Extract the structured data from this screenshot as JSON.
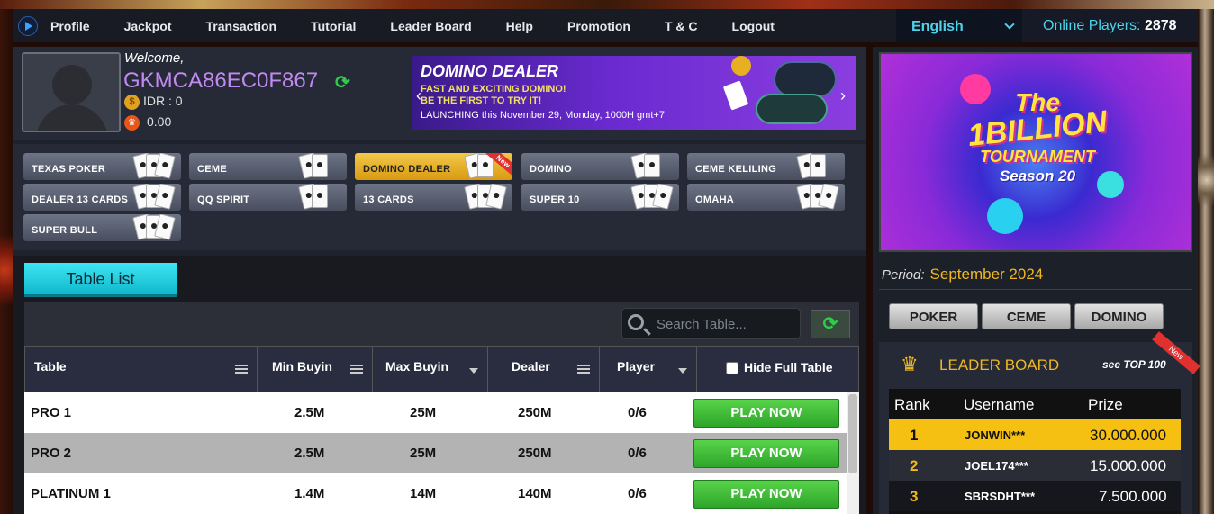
{
  "nav": {
    "items": [
      "Profile",
      "Jackpot",
      "Transaction",
      "Tutorial",
      "Leader Board",
      "Help",
      "Promotion",
      "T & C",
      "Logout"
    ],
    "language": "English",
    "online_label": "Online Players:",
    "online_count": "2878"
  },
  "user": {
    "welcome": "Welcome,",
    "username": "GKMCA86EC0F867",
    "balance": "IDR : 0",
    "points": "0.00"
  },
  "banner": {
    "title": "DOMINO DEALER",
    "line1": "FAST AND EXCITING DOMINO!",
    "line2": "BE THE FIRST TO TRY IT!",
    "line3": "LAUNCHING this November 29, Monday, 1000H gmt+7"
  },
  "games": [
    "TEXAS POKER",
    "CEME",
    "DOMINO DEALER",
    "DOMINO",
    "CEME KELILING",
    "DEALER 13 CARDS",
    "QQ SPIRIT",
    "13 CARDS",
    "SUPER 10",
    "OMAHA",
    "SUPER BULL"
  ],
  "games_active": "DOMINO DEALER",
  "games_new_badge": "New",
  "table": {
    "tab_label": "Table List",
    "search_placeholder": "Search Table...",
    "headers": [
      "Table",
      "Min Buyin",
      "Max Buyin",
      "Dealer",
      "Player"
    ],
    "hide_full": "Hide Full Table",
    "rows": [
      {
        "name": "PRO 1",
        "min": "2.5M",
        "max": "25M",
        "dealer": "250M",
        "player": "0/6",
        "action": "PLAY NOW"
      },
      {
        "name": "PRO 2",
        "min": "2.5M",
        "max": "25M",
        "dealer": "250M",
        "player": "0/6",
        "action": "PLAY NOW"
      },
      {
        "name": "PLATINUM 1",
        "min": "1.4M",
        "max": "14M",
        "dealer": "140M",
        "player": "0/6",
        "action": "PLAY NOW"
      }
    ]
  },
  "tournament": {
    "l1": "The",
    "l2": "1BILLION",
    "l3": "TOURNAMENT",
    "l4": "Season 20"
  },
  "period": {
    "label": "Period:",
    "value": "September 2024"
  },
  "lb_tabs": [
    "POKER",
    "CEME",
    "DOMINO"
  ],
  "leaderboard": {
    "title": "LEADER BOARD",
    "see": "see TOP 100",
    "badge": "New",
    "headers": [
      "Rank",
      "Username",
      "Prize"
    ],
    "rows": [
      {
        "rank": "1",
        "user": "JONWIN***",
        "prize": "30.000.000"
      },
      {
        "rank": "2",
        "user": "JOEL174***",
        "prize": "15.000.000"
      },
      {
        "rank": "3",
        "user": "SBRSDHT***",
        "prize": "7.500.000"
      }
    ]
  },
  "colors": {
    "accent": "#4fd1e8",
    "gold": "#f0b820",
    "green": "#2ecc4a",
    "purple": "#c28af0"
  }
}
